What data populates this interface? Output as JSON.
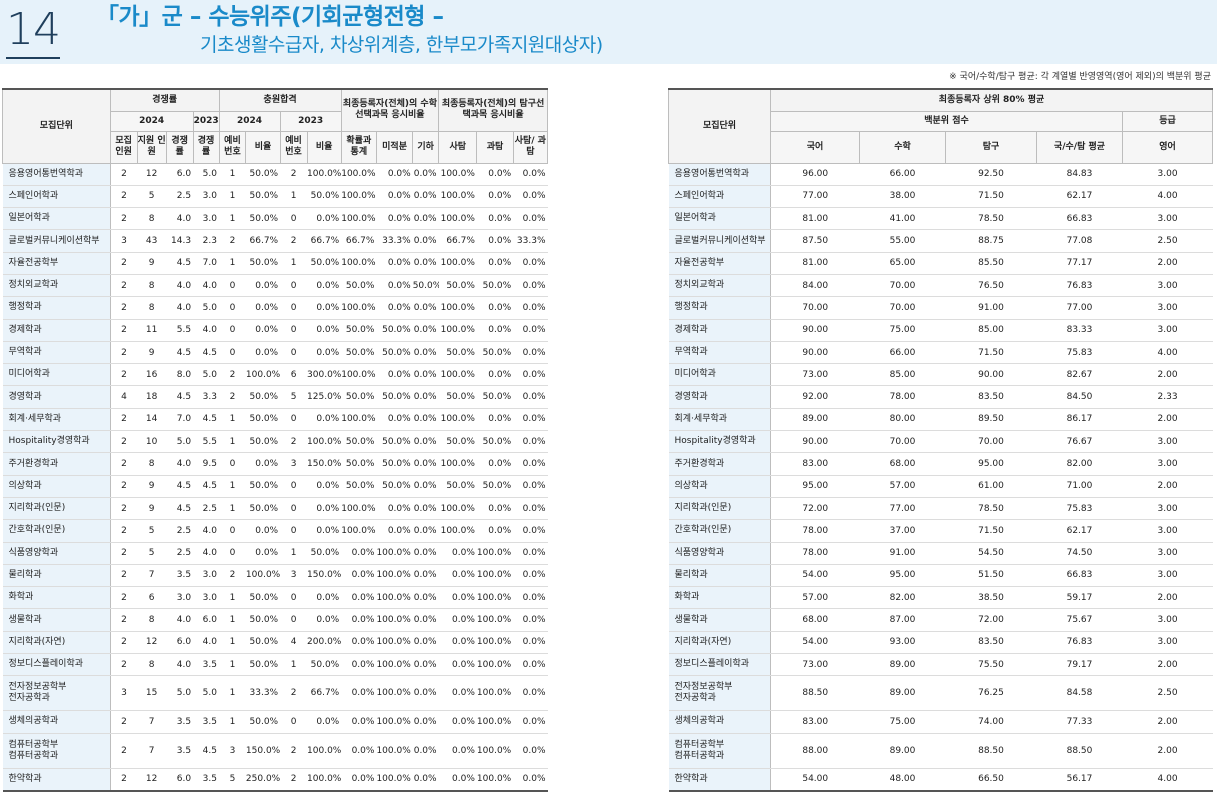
{
  "header": {
    "page_number": "14",
    "title_line1": "「가」군 – 수능위주(기회균형전형 –",
    "title_line2": "기초생활수급자, 차상위계층, 한부모가족지원대상자)",
    "note": "※ 국어/수학/탐구 평균: 각 계열별 반영영역(영어 제외)의 백분위 평균"
  },
  "left_table": {
    "headers": {
      "unit": "모집단위",
      "competition": "경쟁률",
      "year_2024": "2024",
      "year_2023": "2023",
      "reserve": "충원합격",
      "reserve_2024": "2024",
      "reserve_2023": "2023",
      "math_ratio": "최종등록자(전체)의 수학선택과목 응시비율",
      "inquiry_ratio": "최종등록자(전체)의 탐구선택과목 응시비율",
      "cols": [
        "모집 인원",
        "지원 인원",
        "경쟁 률",
        "경쟁 률",
        "예비 번호",
        "비율",
        "예비 번호",
        "비율",
        "확률과 통계",
        "미적분",
        "기하",
        "사탐",
        "과탐",
        "사탐/ 과탐"
      ]
    },
    "rows": [
      [
        "응용영어통번역학과",
        "2",
        "12",
        "6.0",
        "5.0",
        "1",
        "50.0%",
        "2",
        "100.0%",
        "100.0%",
        "0.0%",
        "0.0%",
        "100.0%",
        "0.0%",
        "0.0%"
      ],
      [
        "스페인어학과",
        "2",
        "5",
        "2.5",
        "3.0",
        "1",
        "50.0%",
        "1",
        "50.0%",
        "100.0%",
        "0.0%",
        "0.0%",
        "100.0%",
        "0.0%",
        "0.0%"
      ],
      [
        "일본어학과",
        "2",
        "8",
        "4.0",
        "3.0",
        "1",
        "50.0%",
        "0",
        "0.0%",
        "100.0%",
        "0.0%",
        "0.0%",
        "100.0%",
        "0.0%",
        "0.0%"
      ],
      [
        "글로벌커뮤니케이션학부",
        "3",
        "43",
        "14.3",
        "2.3",
        "2",
        "66.7%",
        "2",
        "66.7%",
        "66.7%",
        "33.3%",
        "0.0%",
        "66.7%",
        "0.0%",
        "33.3%"
      ],
      [
        "자율전공학부",
        "2",
        "9",
        "4.5",
        "7.0",
        "1",
        "50.0%",
        "1",
        "50.0%",
        "100.0%",
        "0.0%",
        "0.0%",
        "100.0%",
        "0.0%",
        "0.0%"
      ],
      [
        "정치외교학과",
        "2",
        "8",
        "4.0",
        "4.0",
        "0",
        "0.0%",
        "0",
        "0.0%",
        "50.0%",
        "0.0%",
        "50.0%",
        "50.0%",
        "50.0%",
        "0.0%"
      ],
      [
        "행정학과",
        "2",
        "8",
        "4.0",
        "5.0",
        "0",
        "0.0%",
        "0",
        "0.0%",
        "100.0%",
        "0.0%",
        "0.0%",
        "100.0%",
        "0.0%",
        "0.0%"
      ],
      [
        "경제학과",
        "2",
        "11",
        "5.5",
        "4.0",
        "0",
        "0.0%",
        "0",
        "0.0%",
        "50.0%",
        "50.0%",
        "0.0%",
        "100.0%",
        "0.0%",
        "0.0%"
      ],
      [
        "무역학과",
        "2",
        "9",
        "4.5",
        "4.5",
        "0",
        "0.0%",
        "0",
        "0.0%",
        "50.0%",
        "50.0%",
        "0.0%",
        "50.0%",
        "50.0%",
        "0.0%"
      ],
      [
        "미디어학과",
        "2",
        "16",
        "8.0",
        "5.0",
        "2",
        "100.0%",
        "6",
        "300.0%",
        "100.0%",
        "0.0%",
        "0.0%",
        "100.0%",
        "0.0%",
        "0.0%"
      ],
      [
        "경영학과",
        "4",
        "18",
        "4.5",
        "3.3",
        "2",
        "50.0%",
        "5",
        "125.0%",
        "50.0%",
        "50.0%",
        "0.0%",
        "50.0%",
        "50.0%",
        "0.0%"
      ],
      [
        "회계·세무학과",
        "2",
        "14",
        "7.0",
        "4.5",
        "1",
        "50.0%",
        "0",
        "0.0%",
        "100.0%",
        "0.0%",
        "0.0%",
        "100.0%",
        "0.0%",
        "0.0%"
      ],
      [
        "Hospitality경영학과",
        "2",
        "10",
        "5.0",
        "5.5",
        "1",
        "50.0%",
        "2",
        "100.0%",
        "50.0%",
        "50.0%",
        "0.0%",
        "50.0%",
        "50.0%",
        "0.0%"
      ],
      [
        "주거환경학과",
        "2",
        "8",
        "4.0",
        "9.5",
        "0",
        "0.0%",
        "3",
        "150.0%",
        "50.0%",
        "50.0%",
        "0.0%",
        "100.0%",
        "0.0%",
        "0.0%"
      ],
      [
        "의상학과",
        "2",
        "9",
        "4.5",
        "4.5",
        "1",
        "50.0%",
        "0",
        "0.0%",
        "50.0%",
        "50.0%",
        "0.0%",
        "50.0%",
        "50.0%",
        "0.0%"
      ],
      [
        "지리학과(인문)",
        "2",
        "9",
        "4.5",
        "2.5",
        "1",
        "50.0%",
        "0",
        "0.0%",
        "100.0%",
        "0.0%",
        "0.0%",
        "100.0%",
        "0.0%",
        "0.0%"
      ],
      [
        "간호학과(인문)",
        "2",
        "5",
        "2.5",
        "4.0",
        "0",
        "0.0%",
        "0",
        "0.0%",
        "100.0%",
        "0.0%",
        "0.0%",
        "100.0%",
        "0.0%",
        "0.0%"
      ],
      [
        "식품영양학과",
        "2",
        "5",
        "2.5",
        "4.0",
        "0",
        "0.0%",
        "1",
        "50.0%",
        "0.0%",
        "100.0%",
        "0.0%",
        "0.0%",
        "100.0%",
        "0.0%"
      ],
      [
        "물리학과",
        "2",
        "7",
        "3.5",
        "3.0",
        "2",
        "100.0%",
        "3",
        "150.0%",
        "0.0%",
        "100.0%",
        "0.0%",
        "0.0%",
        "100.0%",
        "0.0%"
      ],
      [
        "화학과",
        "2",
        "6",
        "3.0",
        "3.0",
        "1",
        "50.0%",
        "0",
        "0.0%",
        "0.0%",
        "100.0%",
        "0.0%",
        "0.0%",
        "100.0%",
        "0.0%"
      ],
      [
        "생물학과",
        "2",
        "8",
        "4.0",
        "6.0",
        "1",
        "50.0%",
        "0",
        "0.0%",
        "0.0%",
        "100.0%",
        "0.0%",
        "0.0%",
        "100.0%",
        "0.0%"
      ],
      [
        "지리학과(자연)",
        "2",
        "12",
        "6.0",
        "4.0",
        "1",
        "50.0%",
        "4",
        "200.0%",
        "0.0%",
        "100.0%",
        "0.0%",
        "0.0%",
        "100.0%",
        "0.0%"
      ],
      [
        "정보디스플레이학과",
        "2",
        "8",
        "4.0",
        "3.5",
        "1",
        "50.0%",
        "1",
        "50.0%",
        "0.0%",
        "100.0%",
        "0.0%",
        "0.0%",
        "100.0%",
        "0.0%"
      ],
      [
        "전자정보공학부\n전자공학과",
        "3",
        "15",
        "5.0",
        "5.0",
        "1",
        "33.3%",
        "2",
        "66.7%",
        "0.0%",
        "100.0%",
        "0.0%",
        "0.0%",
        "100.0%",
        "0.0%"
      ],
      [
        "생체의공학과",
        "2",
        "7",
        "3.5",
        "3.5",
        "1",
        "50.0%",
        "0",
        "0.0%",
        "0.0%",
        "100.0%",
        "0.0%",
        "0.0%",
        "100.0%",
        "0.0%"
      ],
      [
        "컴퓨터공학부\n컴퓨터공학과",
        "2",
        "7",
        "3.5",
        "4.5",
        "3",
        "150.0%",
        "2",
        "100.0%",
        "0.0%",
        "100.0%",
        "0.0%",
        "0.0%",
        "100.0%",
        "0.0%"
      ],
      [
        "한약학과",
        "2",
        "12",
        "6.0",
        "3.5",
        "5",
        "250.0%",
        "2",
        "100.0%",
        "0.0%",
        "100.0%",
        "0.0%",
        "0.0%",
        "100.0%",
        "0.0%"
      ]
    ]
  },
  "right_table": {
    "headers": {
      "unit": "모집단위",
      "top": "최종등록자 상위 80% 평균",
      "percentile": "백분위 점수",
      "grade": "등급",
      "cols": [
        "국어",
        "수학",
        "탐구",
        "국/수/탐 평균",
        "영어"
      ]
    },
    "rows": [
      [
        "응용영어통번역학과",
        "96.00",
        "66.00",
        "92.50",
        "84.83",
        "3.00"
      ],
      [
        "스페인어학과",
        "77.00",
        "38.00",
        "71.50",
        "62.17",
        "4.00"
      ],
      [
        "일본어학과",
        "81.00",
        "41.00",
        "78.50",
        "66.83",
        "3.00"
      ],
      [
        "글로벌커뮤니케이션학부",
        "87.50",
        "55.00",
        "88.75",
        "77.08",
        "2.50"
      ],
      [
        "자율전공학부",
        "81.00",
        "65.00",
        "85.50",
        "77.17",
        "2.00"
      ],
      [
        "정치외교학과",
        "84.00",
        "70.00",
        "76.50",
        "76.83",
        "3.00"
      ],
      [
        "행정학과",
        "70.00",
        "70.00",
        "91.00",
        "77.00",
        "3.00"
      ],
      [
        "경제학과",
        "90.00",
        "75.00",
        "85.00",
        "83.33",
        "3.00"
      ],
      [
        "무역학과",
        "90.00",
        "66.00",
        "71.50",
        "75.83",
        "4.00"
      ],
      [
        "미디어학과",
        "73.00",
        "85.00",
        "90.00",
        "82.67",
        "2.00"
      ],
      [
        "경영학과",
        "92.00",
        "78.00",
        "83.50",
        "84.50",
        "2.33"
      ],
      [
        "회계·세무학과",
        "89.00",
        "80.00",
        "89.50",
        "86.17",
        "2.00"
      ],
      [
        "Hospitality경영학과",
        "90.00",
        "70.00",
        "70.00",
        "76.67",
        "3.00"
      ],
      [
        "주거환경학과",
        "83.00",
        "68.00",
        "95.00",
        "82.00",
        "3.00"
      ],
      [
        "의상학과",
        "95.00",
        "57.00",
        "61.00",
        "71.00",
        "2.00"
      ],
      [
        "지리학과(인문)",
        "72.00",
        "77.00",
        "78.50",
        "75.83",
        "3.00"
      ],
      [
        "간호학과(인문)",
        "78.00",
        "37.00",
        "71.50",
        "62.17",
        "3.00"
      ],
      [
        "식품영양학과",
        "78.00",
        "91.00",
        "54.50",
        "74.50",
        "3.00"
      ],
      [
        "물리학과",
        "54.00",
        "95.00",
        "51.50",
        "66.83",
        "3.00"
      ],
      [
        "화학과",
        "57.00",
        "82.00",
        "38.50",
        "59.17",
        "2.00"
      ],
      [
        "생물학과",
        "68.00",
        "87.00",
        "72.00",
        "75.67",
        "3.00"
      ],
      [
        "지리학과(자연)",
        "54.00",
        "93.00",
        "83.50",
        "76.83",
        "3.00"
      ],
      [
        "정보디스플레이학과",
        "73.00",
        "89.00",
        "75.50",
        "79.17",
        "2.00"
      ],
      [
        "전자정보공학부\n전자공학과",
        "88.50",
        "89.00",
        "76.25",
        "84.58",
        "2.50"
      ],
      [
        "생체의공학과",
        "83.00",
        "75.00",
        "74.00",
        "77.33",
        "2.00"
      ],
      [
        "컴퓨터공학부\n컴퓨터공학과",
        "88.00",
        "89.00",
        "88.50",
        "88.50",
        "2.00"
      ],
      [
        "한약학과",
        "54.00",
        "48.00",
        "66.50",
        "56.17",
        "4.00"
      ]
    ]
  }
}
